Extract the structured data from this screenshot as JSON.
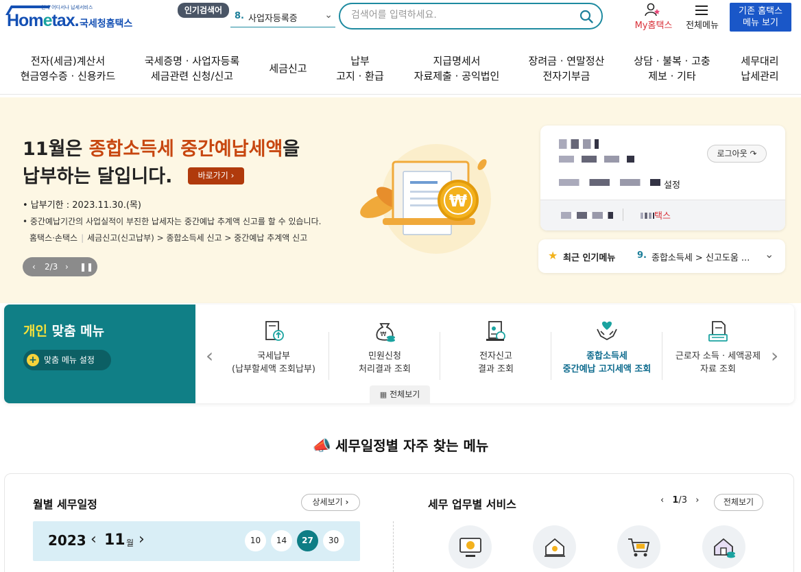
{
  "header": {
    "logo_tag": "언제 어디서나 납세서비스",
    "logo_home": "Hom",
    "logo_e": "e",
    "logo_tax": "tax.",
    "logo_kr": "국세청홈택스",
    "popular_badge": "인기검색어",
    "popular_num": "8.",
    "popular_text": "사업자등록증",
    "search_placeholder": "검색어를 입력하세요.",
    "my_hometax": "My홈택스",
    "all_menu": "전체메뉴",
    "old_hometax_line1": "기존 홈택스",
    "old_hometax_line2": "메뉴 보기"
  },
  "nav": [
    {
      "l1": "전자(세금)계산서",
      "l2": "현금영수증 · 신용카드"
    },
    {
      "l1": "국세증명 · 사업자등록",
      "l2": "세금관련 신청/신고"
    },
    {
      "l1": "세금신고",
      "l2": ""
    },
    {
      "l1": "납부",
      "l2": "고지 · 환급"
    },
    {
      "l1": "지급명세서",
      "l2": "자료제출 · 공익법인"
    },
    {
      "l1": "장려금 · 연말정산",
      "l2": "전자기부금"
    },
    {
      "l1": "상담 · 불복 · 고충",
      "l2": "제보 · 기타"
    },
    {
      "l1": "세무대리",
      "l2": "납세관리"
    }
  ],
  "banner": {
    "title_a": "11월은 ",
    "title_hl": "종합소득세 중간예납세액",
    "title_b": "을",
    "title_line2": "납부하는 달입니다.",
    "go_button": "바로가기",
    "due": "• 납부기한 : 2023.11.30.(목)",
    "desc": "• 중간예납기간의 사업실적이 부진한 납세자는 중간예납 추계액 신고를 할 수 있습니다.",
    "path_a": "홈택스·손택스",
    "path_b": "세금신고(신고납부) > 종합소득세 신고 > 중간예납 추계액 신고",
    "pager": "2/3"
  },
  "user": {
    "setting": "설정",
    "logout": "로그아웃",
    "site": "택스"
  },
  "recent": {
    "label": "최근 인기메뉴",
    "num": "9.",
    "text": "종합소득세 > 신고도움 ..."
  },
  "personal": {
    "title_y": "개인",
    "title_w": " 맞춤 메뉴",
    "setting": "맞춤 메뉴 설정",
    "all": "전체보기",
    "items": [
      {
        "l1": "국세납부",
        "l2": "(납부할세액 조회납부)"
      },
      {
        "l1": "민원신청",
        "l2": "처리결과 조회"
      },
      {
        "l1": "전자신고",
        "l2": "결과 조회"
      },
      {
        "l1": "종합소득세",
        "l2": "중간예납 고지세액 조회"
      },
      {
        "l1": "근로자 소득 · 세액공제",
        "l2": "자료 조회"
      }
    ],
    "highlight_color": "#0e6b8e"
  },
  "schedule": {
    "section_title": "세무일정별 자주 찾는 메뉴",
    "monthly_title": "월별 세무일정",
    "more": "상세보기",
    "year": "2023",
    "month": "11",
    "month_unit": "월",
    "days": [
      "10",
      "14",
      "27",
      "30"
    ],
    "active_day": "27",
    "service_title": "세무 업무별 서비스",
    "service_page": "1",
    "service_total": "3",
    "service_all": "전체보기"
  }
}
